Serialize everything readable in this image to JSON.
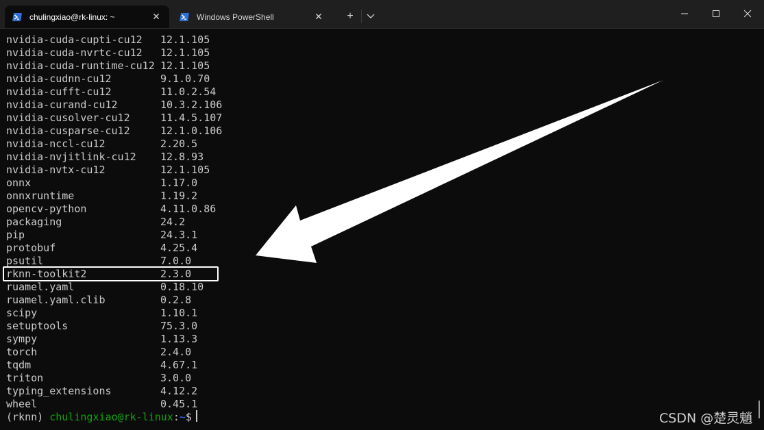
{
  "tabs": [
    {
      "label": "chulingxiao@rk-linux: ~",
      "close": "✕"
    },
    {
      "label": "Windows PowerShell",
      "close": "✕"
    }
  ],
  "toolbar": {
    "new_tab": "+",
    "dropdown": "⌄"
  },
  "window": {
    "minimize": "—",
    "maximize": "☐",
    "close": "✕"
  },
  "packages": [
    {
      "name": "nvidia-cuda-cupti-cu12",
      "version": "12.1.105"
    },
    {
      "name": "nvidia-cuda-nvrtc-cu12",
      "version": "12.1.105"
    },
    {
      "name": "nvidia-cuda-runtime-cu12",
      "version": "12.1.105"
    },
    {
      "name": "nvidia-cudnn-cu12",
      "version": "9.1.0.70"
    },
    {
      "name": "nvidia-cufft-cu12",
      "version": "11.0.2.54"
    },
    {
      "name": "nvidia-curand-cu12",
      "version": "10.3.2.106"
    },
    {
      "name": "nvidia-cusolver-cu12",
      "version": "11.4.5.107"
    },
    {
      "name": "nvidia-cusparse-cu12",
      "version": "12.1.0.106"
    },
    {
      "name": "nvidia-nccl-cu12",
      "version": "2.20.5"
    },
    {
      "name": "nvidia-nvjitlink-cu12",
      "version": "12.8.93"
    },
    {
      "name": "nvidia-nvtx-cu12",
      "version": "12.1.105"
    },
    {
      "name": "onnx",
      "version": "1.17.0"
    },
    {
      "name": "onnxruntime",
      "version": "1.19.2"
    },
    {
      "name": "opencv-python",
      "version": "4.11.0.86"
    },
    {
      "name": "packaging",
      "version": "24.2"
    },
    {
      "name": "pip",
      "version": "24.3.1"
    },
    {
      "name": "protobuf",
      "version": "4.25.4"
    },
    {
      "name": "psutil",
      "version": "7.0.0"
    },
    {
      "name": "rknn-toolkit2",
      "version": "2.3.0"
    },
    {
      "name": "ruamel.yaml",
      "version": "0.18.10"
    },
    {
      "name": "ruamel.yaml.clib",
      "version": "0.2.8"
    },
    {
      "name": "scipy",
      "version": "1.10.1"
    },
    {
      "name": "setuptools",
      "version": "75.3.0"
    },
    {
      "name": "sympy",
      "version": "1.13.3"
    },
    {
      "name": "torch",
      "version": "2.4.0"
    },
    {
      "name": "tqdm",
      "version": "4.67.1"
    },
    {
      "name": "triton",
      "version": "3.0.0"
    },
    {
      "name": "typing_extensions",
      "version": "4.12.2"
    },
    {
      "name": "wheel",
      "version": "0.45.1"
    }
  ],
  "prompt": {
    "env": "(rknn) ",
    "user": "chulingxiao@rk-linux",
    "sep": ":",
    "path": "~",
    "symbol": "$"
  },
  "watermark": "CSDN @楚灵魈",
  "colors": {
    "background": "#0c0c0c",
    "prompt_user": "#13a10e",
    "prompt_path": "#3b78ff",
    "text": "#cccccc"
  }
}
